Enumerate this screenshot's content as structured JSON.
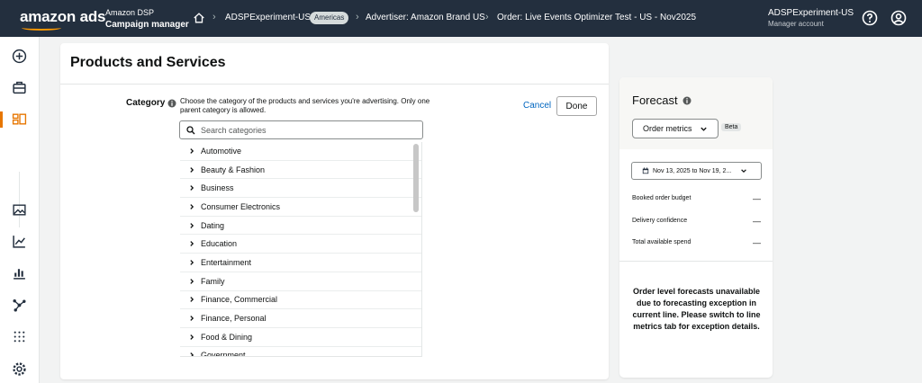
{
  "header": {
    "logo": "amazon ads",
    "product_line1": "Amazon DSP",
    "product_line2": "Campaign manager",
    "breadcrumbs": [
      {
        "label": "ADSPExperiment-US",
        "badge": "Americas"
      },
      {
        "label": "Advertiser: Amazon Brand US"
      },
      {
        "label": "Order: Live Events Optimizer Test - US - Nov2025"
      }
    ],
    "account_name": "ADSPExperiment-US",
    "account_role": "Manager account",
    "icons": [
      "home-icon",
      "help-icon",
      "user-icon"
    ]
  },
  "leftnav": {
    "icons": [
      "plus-circle-icon",
      "briefcase-icon",
      "campaign-icon",
      "image-icon",
      "trend-icon",
      "bar-chart-icon",
      "network-icon",
      "grid-icon",
      "settings-icon"
    ],
    "active_color": "#e77600"
  },
  "section": {
    "title": "Products and Services",
    "category_label": "Category",
    "category_help": "Choose the category of the products and services you're advertising. Only one parent category is allowed.",
    "cancel_label": "Cancel",
    "done_label": "Done",
    "search_placeholder": "Search categories",
    "categories": [
      "Automotive",
      "Beauty & Fashion",
      "Business",
      "Consumer Electronics",
      "Dating",
      "Education",
      "Entertainment",
      "Family",
      "Finance, Commercial",
      "Finance, Personal",
      "Food & Dining",
      "Government"
    ]
  },
  "forecast": {
    "title": "Forecast",
    "metrics_button": "Order metrics",
    "beta_badge": "Beta",
    "date_range": "Nov 13, 2025 to Nov 19, 2...",
    "metrics": [
      {
        "label": "Booked order budget",
        "value": "—"
      },
      {
        "label": "Delivery confidence",
        "value": "—"
      },
      {
        "label": "Total available spend",
        "value": "—"
      }
    ],
    "message": "Order level forecasts unavailable due to forecasting exception in current line. Please switch to line metrics tab for exception details."
  },
  "colors": {
    "header_bg": "#232f3e",
    "accent": "#ff9900",
    "link": "#0066c0"
  }
}
